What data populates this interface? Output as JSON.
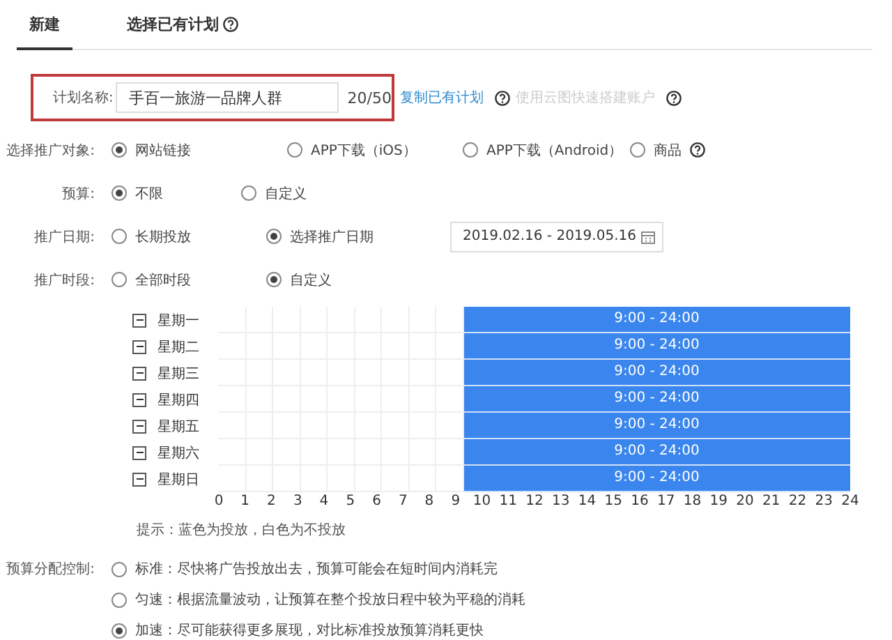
{
  "tabs": [
    {
      "label": "新建",
      "selected": true,
      "help": false
    },
    {
      "label": "选择已有计划",
      "selected": false,
      "help": true
    }
  ],
  "plan_name": {
    "label": "计划名称:",
    "value": "手百一旅游一品牌人群",
    "counter": "20/50",
    "highlighted": true,
    "links": [
      {
        "label": "复制已有计划",
        "disabled": false
      },
      {
        "label": "使用云图快速搭建账户",
        "disabled": true
      }
    ]
  },
  "groups": [
    {
      "label": "选择推广对象:",
      "options": [
        {
          "kind": "plain",
          "label": "网站链接",
          "selected": true
        },
        {
          "kind": "plain",
          "label": "APP下载（iOS）",
          "selected": false
        },
        {
          "kind": "plain",
          "label": "APP下载（Android）",
          "selected": false
        },
        {
          "kind": "help",
          "label": "商品",
          "selected": false
        }
      ]
    },
    {
      "label": "预算:",
      "options": [
        {
          "kind": "plain",
          "label": "不限",
          "selected": true
        },
        {
          "kind": "plain",
          "label": "自定义",
          "selected": false
        }
      ]
    },
    {
      "label": "推广日期:",
      "options": [
        {
          "kind": "plain",
          "label": "长期投放",
          "selected": false
        },
        {
          "kind": "plain",
          "label": "选择推广日期",
          "selected": true
        }
      ],
      "date_range": "2019.02.16 - 2019.05.16"
    },
    {
      "label": "推广时段:",
      "options": [
        {
          "kind": "plain",
          "label": "全部时段",
          "selected": false
        },
        {
          "kind": "plain",
          "label": "自定义",
          "selected": true
        }
      ]
    }
  ],
  "schedule": {
    "days": [
      {
        "label": "星期一",
        "slot": "9:00 - 24:00",
        "hours": [
          false,
          false,
          false,
          false,
          false,
          false,
          false,
          false,
          false,
          true,
          true,
          true,
          true,
          true,
          true,
          true,
          true,
          true,
          true,
          true,
          true,
          true,
          true,
          true
        ]
      },
      {
        "label": "星期二",
        "slot": "9:00 - 24:00",
        "hours": [
          false,
          false,
          false,
          false,
          false,
          false,
          false,
          false,
          false,
          true,
          true,
          true,
          true,
          true,
          true,
          true,
          true,
          true,
          true,
          true,
          true,
          true,
          true,
          true
        ]
      },
      {
        "label": "星期三",
        "slot": "9:00 - 24:00",
        "hours": [
          false,
          false,
          false,
          false,
          false,
          false,
          false,
          false,
          false,
          true,
          true,
          true,
          true,
          true,
          true,
          true,
          true,
          true,
          true,
          true,
          true,
          true,
          true,
          true
        ]
      },
      {
        "label": "星期四",
        "slot": "9:00 - 24:00",
        "hours": [
          false,
          false,
          false,
          false,
          false,
          false,
          false,
          false,
          false,
          true,
          true,
          true,
          true,
          true,
          true,
          true,
          true,
          true,
          true,
          true,
          true,
          true,
          true,
          true
        ]
      },
      {
        "label": "星期五",
        "slot": "9:00 - 24:00",
        "hours": [
          false,
          false,
          false,
          false,
          false,
          false,
          false,
          false,
          false,
          true,
          true,
          true,
          true,
          true,
          true,
          true,
          true,
          true,
          true,
          true,
          true,
          true,
          true,
          true
        ]
      },
      {
        "label": "星期六",
        "slot": "9:00 - 24:00",
        "hours": [
          false,
          false,
          false,
          false,
          false,
          false,
          false,
          false,
          false,
          true,
          true,
          true,
          true,
          true,
          true,
          true,
          true,
          true,
          true,
          true,
          true,
          true,
          true,
          true
        ]
      },
      {
        "label": "星期日",
        "slot": "9:00 - 24:00",
        "hours": [
          false,
          false,
          false,
          false,
          false,
          false,
          false,
          false,
          false,
          true,
          true,
          true,
          true,
          true,
          true,
          true,
          true,
          true,
          true,
          true,
          true,
          true,
          true,
          true
        ]
      }
    ],
    "ticks": [
      "0",
      "1",
      "2",
      "3",
      "4",
      "5",
      "6",
      "7",
      "8",
      "9",
      "10",
      "11",
      "12",
      "13",
      "14",
      "15",
      "16",
      "17",
      "18",
      "19",
      "20",
      "21",
      "22",
      "23",
      "24"
    ],
    "hint": "提示：蓝色为投放，白色为不投放"
  },
  "budget_control": {
    "label": "预算分配控制:",
    "options": [
      {
        "label": "标准：尽快将广告投放出去，预算可能会在短时间内消耗完",
        "selected": false
      },
      {
        "label": "匀速：根据流量波动，让预算在整个投放日程中较为平稳的消耗",
        "selected": false
      },
      {
        "label": "加速：尽可能获得更多展现，对比标准投放预算消耗更快",
        "selected": true
      }
    ]
  }
}
